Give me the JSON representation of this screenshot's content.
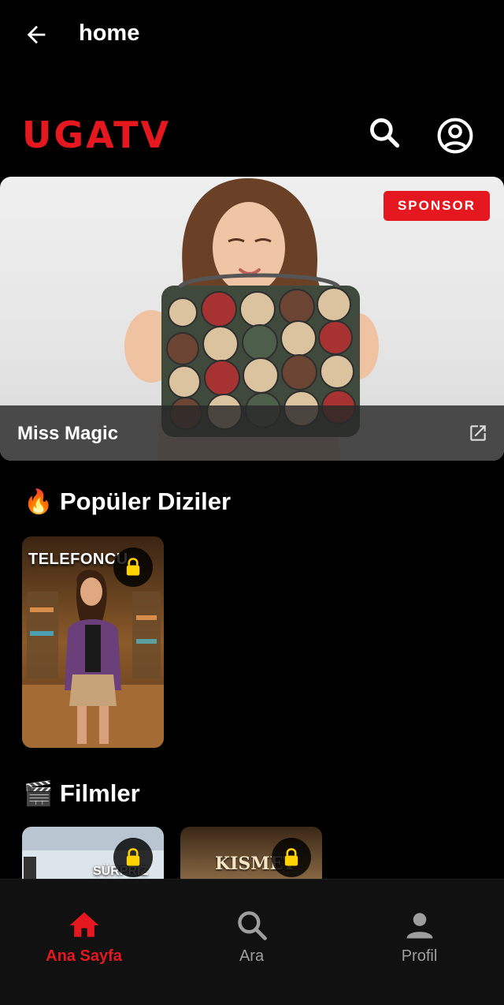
{
  "appbar": {
    "title": "home",
    "back_icon": "arrow-left-icon"
  },
  "header": {
    "logo": "UGATV",
    "search_icon": "search-icon",
    "account_icon": "account-circle-icon"
  },
  "banner": {
    "badge": "SPONSOR",
    "name": "Miss Magic",
    "link_icon": "external-link-icon"
  },
  "sections": {
    "popular": {
      "emoji": "🔥",
      "title": "Popüler Diziler"
    },
    "movies": {
      "emoji": "🎬",
      "title": "Filmler"
    }
  },
  "posters": {
    "popular": [
      {
        "caption": "TELEFONCU",
        "locked": true
      }
    ],
    "movies": [
      {
        "caption": "SÜRPRIZ",
        "locked": true
      },
      {
        "caption": "KISMET",
        "locked": true
      }
    ]
  },
  "bottom_nav": [
    {
      "label": "Ana Sayfa",
      "icon": "home-icon",
      "active": true
    },
    {
      "label": "Ara",
      "icon": "search-icon",
      "active": false
    },
    {
      "label": "Profil",
      "icon": "person-icon",
      "active": false
    }
  ],
  "colors": {
    "accent": "#e5181f",
    "lock": "#ffd200",
    "nav_inactive": "#9e9e9e",
    "background": "#000000"
  }
}
